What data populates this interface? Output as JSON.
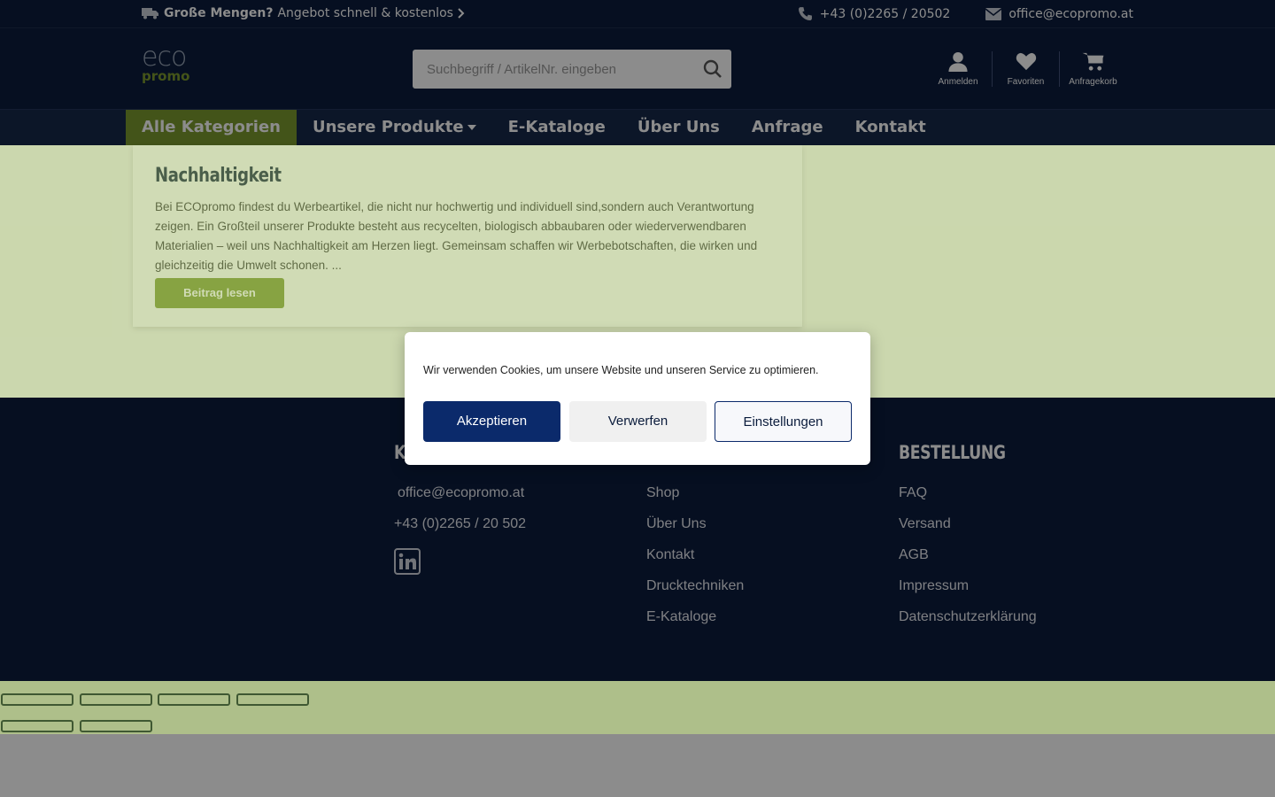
{
  "topbar": {
    "promo_bold": "Große Mengen?",
    "promo_text": "Angebot schnell & kostenlos",
    "phone": "+43 (0)2265 / 20502",
    "email": "office@ecopromo.at"
  },
  "header": {
    "logo_top": "eco",
    "logo_bottom": "promo",
    "search_placeholder": "Suchbegriff / ArtikelNr. eingeben",
    "icons": [
      {
        "label": "Anmelden",
        "icon": "user-icon"
      },
      {
        "label": "Favoriten",
        "icon": "heart-icon"
      },
      {
        "label": "Anfragekorb",
        "icon": "cart-icon"
      }
    ]
  },
  "nav": {
    "items": [
      "Alle Kategorien",
      "Unsere Produkte",
      "E-Kataloge",
      "Über Uns",
      "Anfrage",
      "Kontakt"
    ]
  },
  "post": {
    "title": "Nachhaltigkeit",
    "excerpt": "Bei ECOpromo findest du Werbeartikel, die nicht nur hochwertig und individuell sind,sondern auch Verantwortung zeigen. Ein Großteil unserer Produkte besteht aus recycelten, biologisch abbaubaren oder wiederverwendbaren Materialien – weil uns Nachhaltigkeit am Herzen liegt. Gemeinsam schaffen wir Werbebotschaften, die wirken und gleichzeitig die Umwelt schonen. ...",
    "button": "Beitrag lesen"
  },
  "footer": {
    "col1": {
      "title": "K",
      "email": "office@ecopromo.at",
      "phone": "+43 (0)2265 / 20 502"
    },
    "col2": {
      "links": [
        "Shop",
        "Über Uns",
        "Kontakt",
        "Drucktechniken",
        "E-Kataloge"
      ]
    },
    "col3": {
      "title": "BESTELLUNG",
      "links": [
        "FAQ",
        "Versand",
        "AGB",
        "Impressum",
        "Datenschutzerklärung"
      ]
    }
  },
  "cookie": {
    "message": "Wir verwenden Cookies, um unsere Website und unseren Service zu optimieren.",
    "accept": "Akzeptieren",
    "reject": "Verwerfen",
    "settings": "Einstellungen"
  },
  "colors": {
    "navy": "#0b1c3c",
    "green": "#7a9a2e",
    "accept_blue": "#0b2a6b"
  }
}
